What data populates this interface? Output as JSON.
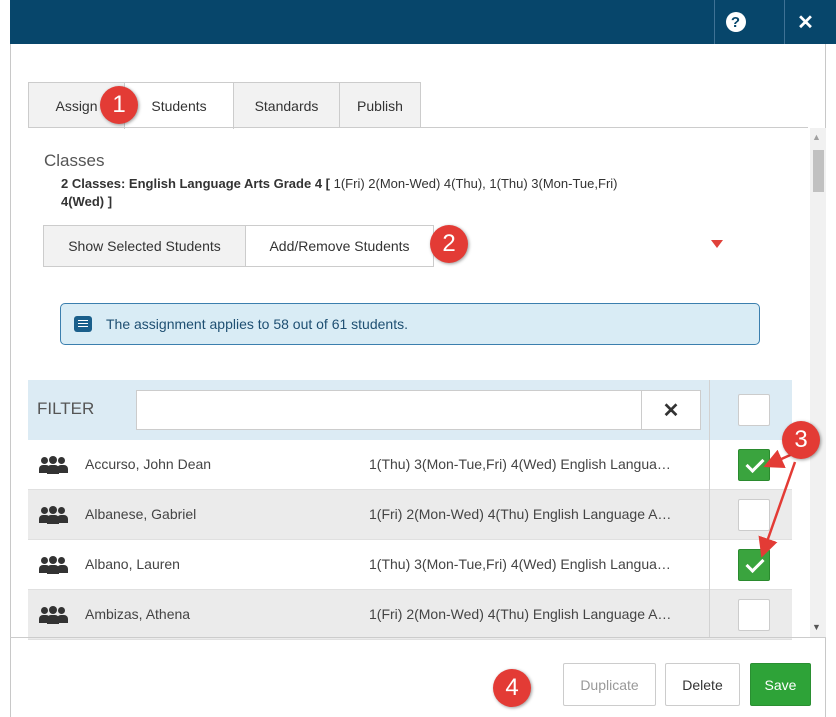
{
  "window": {
    "help_icon": "help-circle-icon",
    "close_icon": "close-icon",
    "help_glyph": "?",
    "close_glyph": "✕"
  },
  "tabs": [
    {
      "label": "Assign"
    },
    {
      "label": "Students"
    },
    {
      "label": "Standards"
    },
    {
      "label": "Publish"
    }
  ],
  "active_tab": "Students",
  "classes": {
    "label": "Classes",
    "summary_bold": "2 Classes: English Language Arts Grade 4 [",
    "summary_rest": " 1(Fri) 2(Mon-Wed) 4(Thu), 1(Thu) 3(Mon-Tue,Fri)",
    "summary_line2": "4(Wed) ]"
  },
  "view_buttons": {
    "show_selected": "Show Selected Students",
    "add_remove": "Add/Remove Students"
  },
  "alert": {
    "text": "The assignment applies to 58 out of 61 students.",
    "icon": "message-icon"
  },
  "filter": {
    "label": "FILTER",
    "value": "",
    "clear_glyph": "✕"
  },
  "students": [
    {
      "name": "Accurso, John Dean",
      "classes": "1(Thu) 3(Mon-Tue,Fri) 4(Wed) English Langua…",
      "checked": true
    },
    {
      "name": "Albanese, Gabriel",
      "classes": "1(Fri) 2(Mon-Wed) 4(Thu) English Language A…",
      "checked": false
    },
    {
      "name": "Albano, Lauren",
      "classes": "1(Thu) 3(Mon-Tue,Fri) 4(Wed) English Langua…",
      "checked": true
    },
    {
      "name": "Ambizas, Athena",
      "classes": "1(Fri) 2(Mon-Wed) 4(Thu) English Language A…",
      "checked": false
    }
  ],
  "footer": {
    "duplicate": "Duplicate",
    "delete": "Delete",
    "save": "Save"
  },
  "annotations": [
    "1",
    "2",
    "3",
    "4"
  ],
  "colors": {
    "header": "#07466b",
    "save": "#2ea338",
    "badge": "#e33b35",
    "alert_bg": "#d9ecf5",
    "filter_bg": "#dcebf4"
  }
}
